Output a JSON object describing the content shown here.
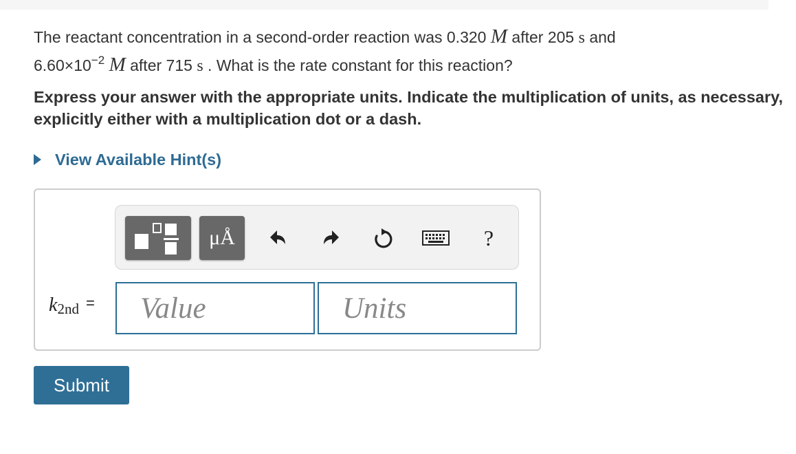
{
  "question": {
    "part1": "The reactant concentration in a second-order reaction was 0.320 ",
    "molar_symbol": "M",
    "part2": " after 205 ",
    "unit_s": "s",
    "part3": " and",
    "part4": "6.60×10",
    "exponent": "−2",
    "part5": " after 715 ",
    "part6": " . What is the rate constant for this reaction?"
  },
  "instruction": "Express your answer with the appropriate units. Indicate the multiplication of units, as necessary, explicitly either with a multiplication dot or a dash.",
  "hint": {
    "label": "View Available Hint(s)"
  },
  "toolbar": {
    "template_button_icon": "fraction-template-icon",
    "units_button_label": "μÅ",
    "undo_icon": "undo-icon",
    "redo_icon": "redo-icon",
    "reset_icon": "reset-icon",
    "keyboard_icon": "keyboard-icon",
    "help_label": "?"
  },
  "answer": {
    "variable": "k",
    "variable_subscript": "2nd",
    "equals": "=",
    "value_placeholder": "Value",
    "units_placeholder": "Units"
  },
  "submit_label": "Submit",
  "colors": {
    "accent": "#2e6b93",
    "submit_bg": "#2f6f96",
    "toolbar_button": "#686868"
  }
}
